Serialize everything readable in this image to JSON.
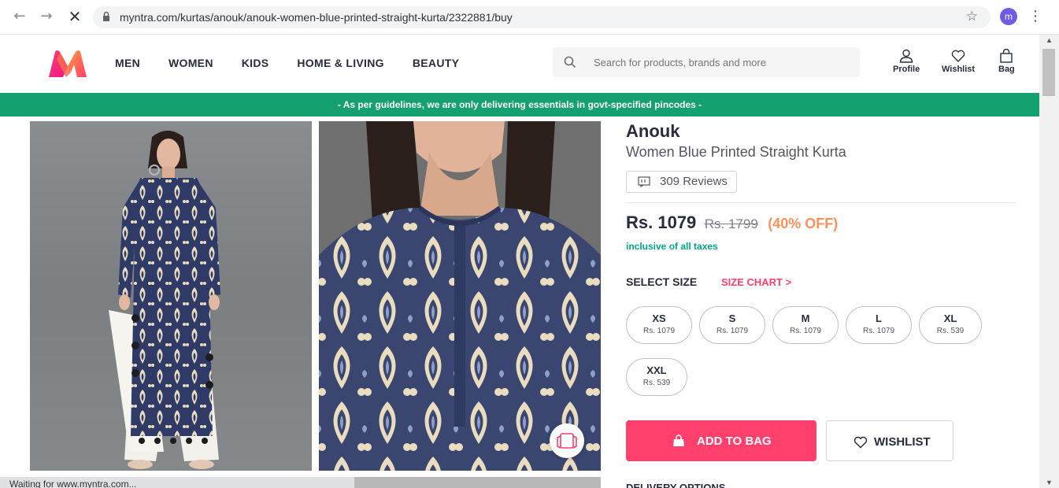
{
  "browser": {
    "url": "myntra.com/kurtas/anouk/anouk-women-blue-printed-straight-kurta/2322881/buy",
    "avatar_letter": "m",
    "status_text": "Waiting for www.myntra.com..."
  },
  "header": {
    "menu": [
      "MEN",
      "WOMEN",
      "KIDS",
      "HOME & LIVING",
      "BEAUTY"
    ],
    "search_placeholder": "Search for products, brands and more",
    "actions": {
      "profile": "Profile",
      "wishlist": "Wishlist",
      "bag": "Bag"
    }
  },
  "banner": "- As per guidelines, we are only delivering essentials in govt-specified pincodes -",
  "product": {
    "brand": "Anouk",
    "name": "Women Blue Printed Straight Kurta",
    "reviews": "309 Reviews",
    "price": "Rs. 1079",
    "mrp": "Rs. 1799",
    "discount": "(40% OFF)",
    "taxes": "inclusive of all taxes",
    "select_size": "SELECT SIZE",
    "size_chart": "SIZE CHART >",
    "sizes": [
      {
        "label": "XS",
        "price": "Rs. 1079"
      },
      {
        "label": "S",
        "price": "Rs. 1079"
      },
      {
        "label": "M",
        "price": "Rs. 1079"
      },
      {
        "label": "L",
        "price": "Rs. 1079"
      },
      {
        "label": "XL",
        "price": "Rs. 539"
      },
      {
        "label": "XXL",
        "price": "Rs. 539"
      }
    ],
    "add_to_bag": "ADD TO BAG",
    "wishlist": "WISHLIST",
    "delivery_options": "DELIVERY OPTIONS"
  },
  "colors": {
    "brand_pink": "#ff3f6c",
    "banner_green": "#14a06f",
    "discount_orange": "#ff905a",
    "tax_green": "#03a685"
  }
}
